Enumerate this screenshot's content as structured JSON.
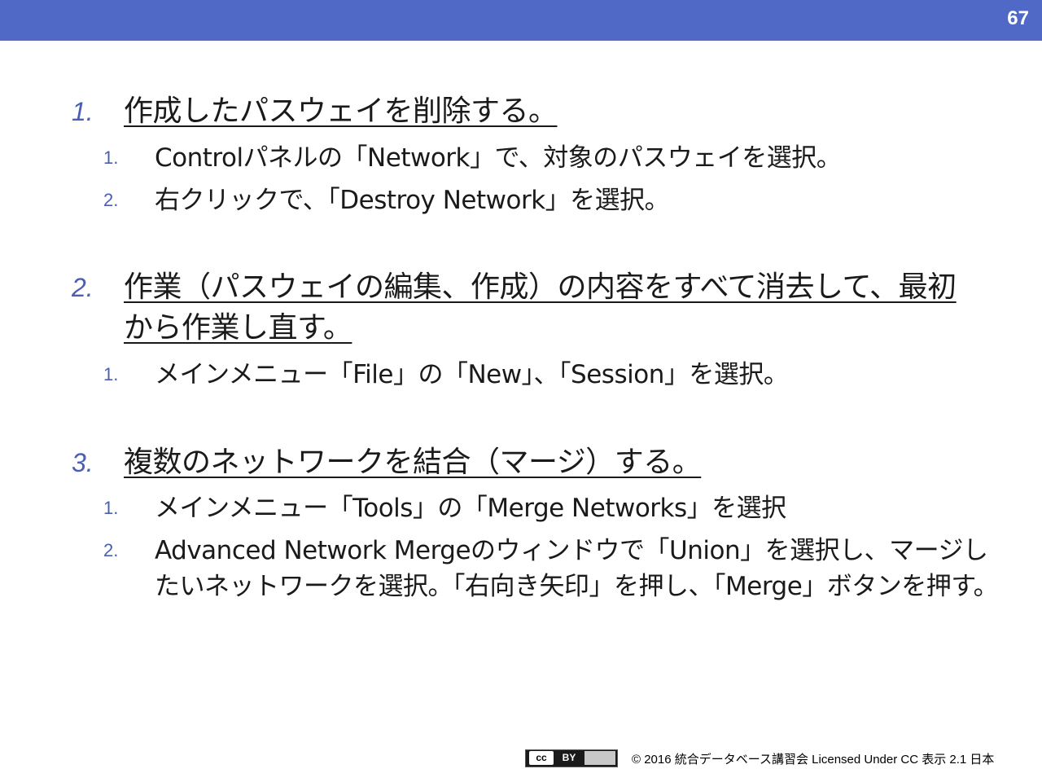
{
  "header": {
    "page_number": "67"
  },
  "items": [
    {
      "number": "1.",
      "text": "作成したパスウェイを削除する。",
      "subitems": [
        {
          "number": "1.",
          "text": "Controlパネルの「Network」で、対象のパスウェイを選択。"
        },
        {
          "number": "2.",
          "text": "右クリックで、「Destroy Network」を選択。"
        }
      ]
    },
    {
      "number": "2.",
      "text": "作業（パスウェイの編集、作成）の内容をすべて消去して、最初から作業し直す。",
      "subitems": [
        {
          "number": "1.",
          "text": "メインメニュー「File」の「New」、「Session」を選択。"
        }
      ]
    },
    {
      "number": "3.",
      "text": "複数のネットワークを結合（マージ）する。",
      "subitems": [
        {
          "number": "1.",
          "text": "メインメニュー「Tools」の「Merge Networks」を選択"
        },
        {
          "number": "2.",
          "text": "Advanced Network Mergeのウィンドウで「Union」を選択し、マージしたいネットワークを選択。「右向き矢印」を押し、「Merge」ボタンを押す。"
        }
      ]
    }
  ],
  "footer": {
    "badge_cc": "cc",
    "badge_by": "BY",
    "license": "© 2016 統合データベース講習会 Licensed Under CC 表示 2.1 日本"
  },
  "colors": {
    "bar": "#5068c6",
    "numbering": "#4a5fb3"
  }
}
